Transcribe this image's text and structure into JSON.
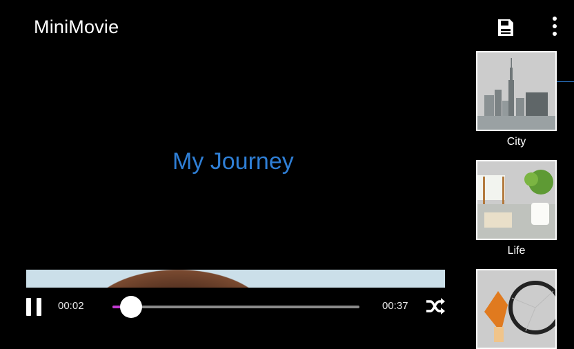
{
  "app": {
    "title": "MiniMovie"
  },
  "toolbar": {
    "save_icon": "save-icon",
    "more_icon": "more-vert-icon"
  },
  "video": {
    "title": "My Journey"
  },
  "player": {
    "current_time": "00:02",
    "total_time": "00:37",
    "progress_fraction": 0.06,
    "pause_icon": "pause-icon",
    "shuffle_icon": "shuffle-icon",
    "accent_color": "#c23bd1"
  },
  "themes": [
    {
      "label": "City",
      "icon": "city-thumbnail"
    },
    {
      "label": "Life",
      "icon": "life-thumbnail"
    },
    {
      "label": "",
      "icon": "cycling-thumbnail"
    }
  ],
  "colors": {
    "title_blue": "#2f7fd6",
    "background": "#000000"
  }
}
